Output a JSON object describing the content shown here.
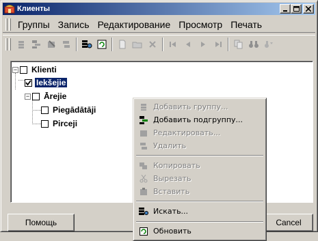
{
  "window": {
    "title": "Клиенты"
  },
  "menubar": [
    "Группы",
    "Запись",
    "Редактирование",
    "Просмотр",
    "Печать"
  ],
  "tree": {
    "root": "Klienti",
    "inner": "Iekšejie",
    "outer": "Ārejie",
    "suppliers": "Piegādātāji",
    "buyers": "Pirceji"
  },
  "buttons": {
    "help": "Помощь",
    "cancel": "Cancel"
  },
  "context_menu": {
    "add_group": "Добавить группу...",
    "add_subgroup": "Добавить подгруппу...",
    "edit": "Редактировать...",
    "delete": "Удалить",
    "copy": "Копировать",
    "cut": "Вырезать",
    "paste": "Вставить",
    "find": "Искать...",
    "refresh": "Обновить"
  },
  "colors": {
    "title_start": "#0a246a",
    "title_end": "#a6caf0",
    "selection": "#0a246a",
    "face": "#d4d0c8"
  }
}
